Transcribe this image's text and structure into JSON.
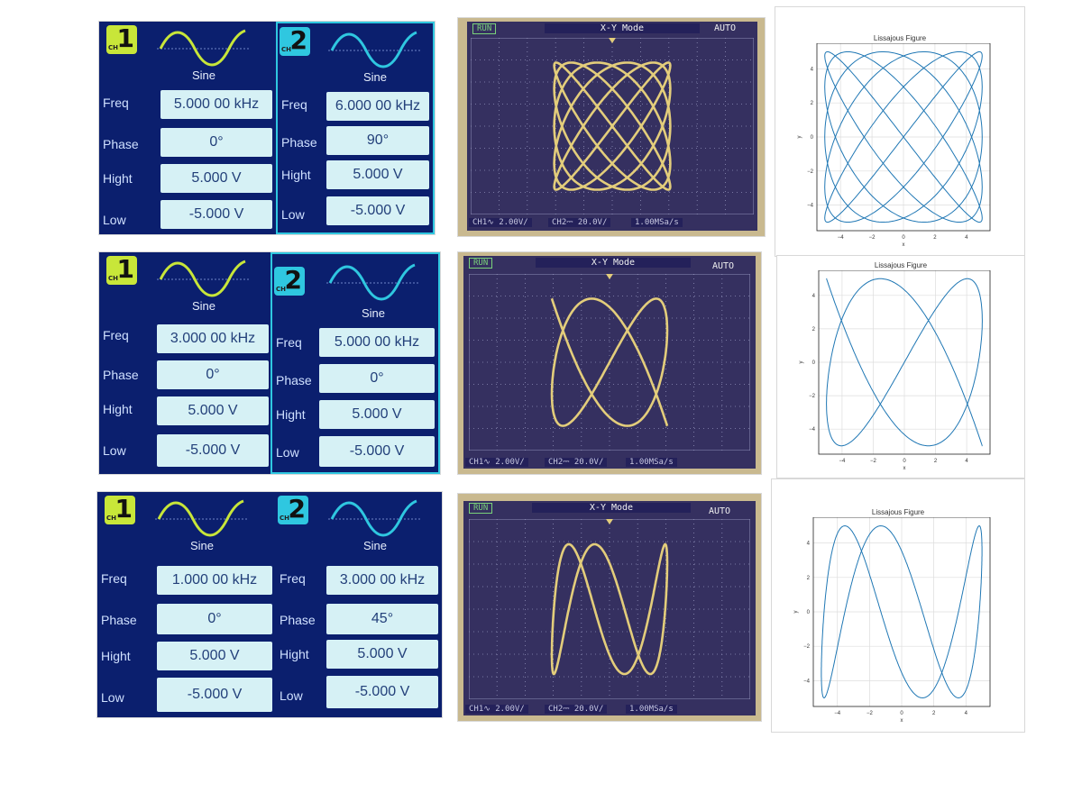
{
  "generators": [
    {
      "ch1": {
        "badge": "CH",
        "number": "1",
        "wave_label": "Sine",
        "freq": "5.000 00 kHz",
        "phase": "0°",
        "high": "5.000 V",
        "low": "-5.000 V"
      },
      "ch2": {
        "badge": "CH",
        "number": "2",
        "wave_label": "Sine",
        "freq": "6.000 00 kHz",
        "phase": "90°",
        "high": "5.000 V",
        "low": "-5.000 V"
      }
    },
    {
      "ch1": {
        "badge": "CH",
        "number": "1",
        "wave_label": "Sine",
        "freq": "3.000 00 kHz",
        "phase": "0°",
        "high": "5.000 V",
        "low": "-5.000 V"
      },
      "ch2": {
        "badge": "CH",
        "number": "2",
        "wave_label": "Sine",
        "freq": "5.000 00 kHz",
        "phase": "0°",
        "high": "5.000 V",
        "low": "-5.000 V"
      }
    },
    {
      "ch1": {
        "badge": "CH",
        "number": "1",
        "wave_label": "Sine",
        "freq": "1.000 00 kHz",
        "phase": "0°",
        "high": "5.000 V",
        "low": "-5.000 V"
      },
      "ch2": {
        "badge": "CH",
        "number": "2",
        "wave_label": "Sine",
        "freq": "3.000 00 kHz",
        "phase": "45°",
        "high": "5.000 V",
        "low": "-5.000 V"
      }
    }
  ],
  "param_labels": {
    "freq": "Freq",
    "phase": "Phase",
    "high": "Hight",
    "low": "Low"
  },
  "scope": {
    "run": "RUN",
    "mode": "X-Y Mode",
    "auto": "AUTO",
    "ch1": "CH1∿  2.00V/",
    "ch2": "CH2⎓  20.0V/",
    "rate": "1.00MSa/s"
  },
  "lissajous_plots": [
    {
      "title": "Lissajous Figure",
      "xlabel": "x",
      "ylabel": "y",
      "a": 5,
      "b": 6,
      "phase_deg": 90,
      "amp": 5,
      "xticks": [
        -4,
        -2,
        0,
        2,
        4
      ],
      "yticks": [
        -4,
        -2,
        0,
        2,
        4
      ]
    },
    {
      "title": "Lissajous Figure",
      "xlabel": "x",
      "ylabel": "y",
      "a": 3,
      "b": 5,
      "phase_deg": 0,
      "amp": 5,
      "xticks": [
        -4,
        -2,
        0,
        2,
        4
      ],
      "yticks": [
        -4,
        -2,
        0,
        2,
        4
      ]
    },
    {
      "title": "Lissajous Figure",
      "xlabel": "x",
      "ylabel": "y",
      "a": 1,
      "b": 3,
      "phase_deg": 45,
      "amp": 5,
      "xticks": [
        -4,
        -2,
        0,
        2,
        4
      ],
      "yticks": [
        -4,
        -2,
        0,
        2,
        4
      ]
    }
  ],
  "colors": {
    "generator_bg": "#0b1f6e",
    "ch1_accent": "#c8e639",
    "ch2_accent": "#2fc7e0",
    "value_box": "#d6f1f5",
    "scope_screen": "#353060",
    "scope_trace": "#e3cd7b",
    "plot_line": "#1f77b4"
  }
}
